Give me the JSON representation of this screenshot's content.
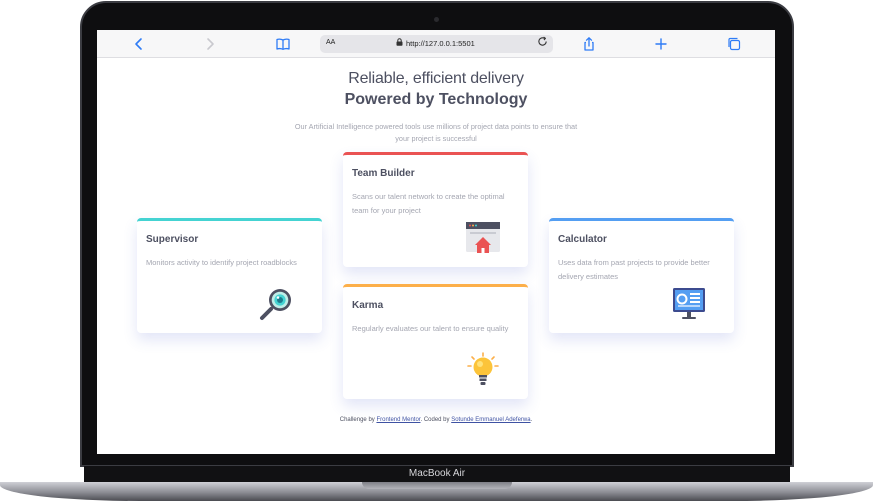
{
  "device": {
    "label": "MacBook Air"
  },
  "browser": {
    "address_prefix": "AA",
    "url": "http://127.0.0.1:5501",
    "icons": [
      "back-icon",
      "forward-icon",
      "bookmarks-icon",
      "lock-icon",
      "reload-icon",
      "share-icon",
      "new-tab-icon",
      "tabs-icon"
    ]
  },
  "page": {
    "heading_light": "Reliable, efficient delivery",
    "heading_bold": "Powered by Technology",
    "intro": "Our Artificial Intelligence powered tools use millions of project data points to ensure that your project is successful",
    "cards": [
      {
        "title": "Supervisor",
        "description": "Monitors activity to identify project roadblocks",
        "accent": "#44d3d2",
        "icon": "magnifier-icon"
      },
      {
        "title": "Team Builder",
        "description": "Scans our talent network to create the optimal team for your project",
        "accent": "#ea5353",
        "icon": "team-builder-icon"
      },
      {
        "title": "Karma",
        "description": "Regularly evaluates our talent to ensure quality",
        "accent": "#fcaf4a",
        "icon": "lightbulb-icon"
      },
      {
        "title": "Calculator",
        "description": "Uses data from past projects to provide better delivery estimates",
        "accent": "#549ef2",
        "icon": "calculator-monitor-icon"
      }
    ],
    "attribution": {
      "prefix": "Challenge by",
      "link1": "Frontend Mentor",
      "middle": ". Coded by",
      "link2": "Sotunde Emmanuel Adeferwa",
      "suffix": "."
    }
  }
}
